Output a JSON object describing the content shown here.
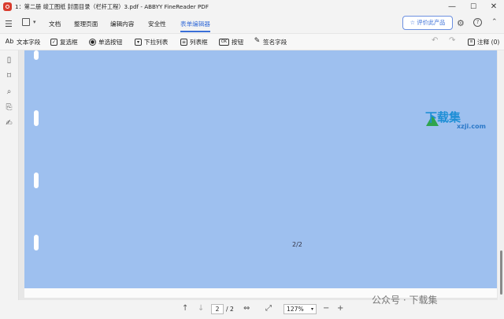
{
  "window": {
    "title": "1：第二册 竣工图纸 封面目录（栏杆工程）3.pdf - ABBYY FineReader PDF",
    "minimize": "—",
    "maximize": "☐",
    "close": "✕"
  },
  "menu": {
    "items": [
      {
        "label": "文档"
      },
      {
        "label": "整理页面"
      },
      {
        "label": "编辑内容"
      },
      {
        "label": "安全性"
      },
      {
        "label": "表单编辑器"
      }
    ],
    "active_index": 4,
    "rate_button": "评价此产品"
  },
  "toolbar": {
    "tools": [
      {
        "label": "文本字段",
        "icon": "text-field-icon",
        "glyph": "Ab"
      },
      {
        "label": "复选框",
        "icon": "checkbox-icon",
        "glyph": "✓"
      },
      {
        "label": "单选按钮",
        "icon": "radio-icon",
        "glyph": "●"
      },
      {
        "label": "下拉列表",
        "icon": "dropdown-icon",
        "glyph": "▾"
      },
      {
        "label": "列表框",
        "icon": "listbox-icon",
        "glyph": "≡"
      },
      {
        "label": "按钮",
        "icon": "button-icon",
        "glyph": "OK"
      },
      {
        "label": "签名字段",
        "icon": "signature-icon",
        "glyph": "✎"
      }
    ],
    "comments": "注释 (0)"
  },
  "document": {
    "page_label": "2/2",
    "page_color": "#9ec0ef"
  },
  "watermark": {
    "logo": "下载集",
    "sub": "xzji.com"
  },
  "status": {
    "current_page": "2",
    "total_pages": "/ 2",
    "zoom": "127%"
  },
  "footer_watermark": "公众号 · 下载集",
  "colors": {
    "accent": "#3a6fd8",
    "brand": "#d93c2e"
  }
}
